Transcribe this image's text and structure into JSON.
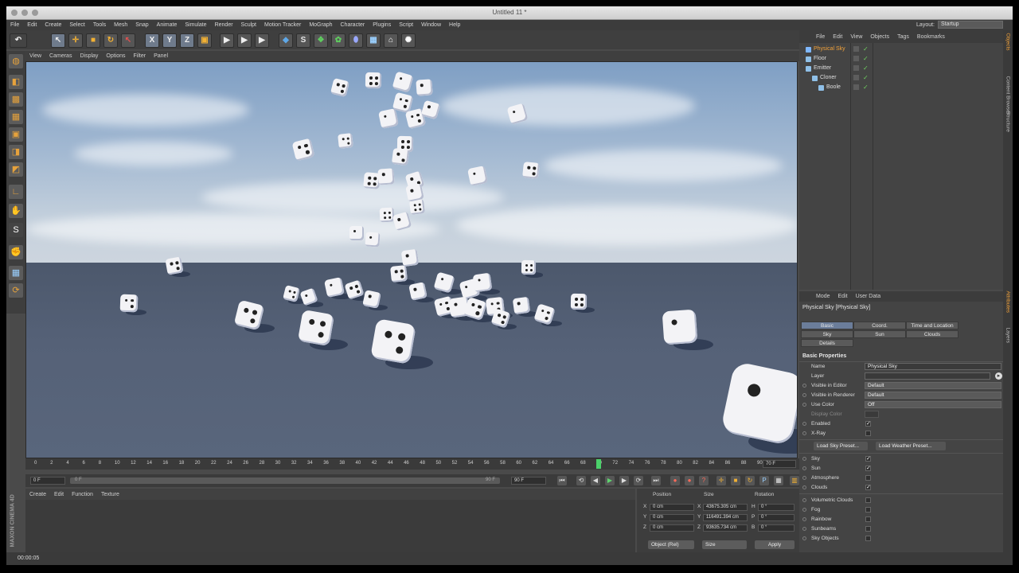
{
  "window": {
    "title": "Untitled 11 *"
  },
  "menu": [
    "File",
    "Edit",
    "Create",
    "Select",
    "Tools",
    "Mesh",
    "Snap",
    "Animate",
    "Simulate",
    "Render",
    "Sculpt",
    "Motion Tracker",
    "MoGraph",
    "Character",
    "Plugins",
    "Script",
    "Window",
    "Help"
  ],
  "layout": {
    "label": "Layout:",
    "value": "Startup"
  },
  "toolbar": {
    "x_label": "X",
    "y_label": "Y",
    "z_label": "Z"
  },
  "viewport_menu": [
    "View",
    "Cameras",
    "Display",
    "Options",
    "Filter",
    "Panel"
  ],
  "timeline": {
    "ticks": [
      "0",
      "2",
      "4",
      "6",
      "8",
      "10",
      "12",
      "14",
      "16",
      "18",
      "20",
      "22",
      "24",
      "26",
      "28",
      "30",
      "32",
      "34",
      "36",
      "38",
      "40",
      "42",
      "44",
      "46",
      "48",
      "50",
      "52",
      "54",
      "56",
      "58",
      "60",
      "62",
      "64",
      "66",
      "68",
      "70",
      "72",
      "74",
      "76",
      "78",
      "80",
      "82",
      "84",
      "86",
      "88",
      "90"
    ],
    "current_label": "70 F",
    "current_frame": 70,
    "max_frame": 90
  },
  "playback": {
    "start_field": "0 F",
    "slider_start": "0 F",
    "slider_end": "90 F",
    "end_field": "90 F"
  },
  "material_menu": [
    "Create",
    "Edit",
    "Function",
    "Texture"
  ],
  "coords": {
    "headers": {
      "position": "Position",
      "size": "Size",
      "rotation": "Rotation"
    },
    "rows": [
      {
        "axis": "X",
        "pos": "0 cm",
        "size_axis": "X",
        "size": "43675.305 cm",
        "rot_axis": "H",
        "rot": "0 °"
      },
      {
        "axis": "Y",
        "pos": "0 cm",
        "size_axis": "Y",
        "size": "116491.394 cm",
        "rot_axis": "P",
        "rot": "0 °"
      },
      {
        "axis": "Z",
        "pos": "0 cm",
        "size_axis": "Z",
        "size": "93635.734 cm",
        "rot_axis": "B",
        "rot": "0 °"
      }
    ],
    "mode": "Object (Rel)",
    "size_mode": "Size",
    "apply": "Apply"
  },
  "status": {
    "time": "00:00:05"
  },
  "brand": {
    "maxon": "MAXON CINEMA 4D"
  },
  "objects_menu": [
    "File",
    "Edit",
    "View",
    "Objects",
    "Tags",
    "Bookmarks"
  ],
  "objects": [
    {
      "name": "Physical Sky",
      "indent": 0,
      "active": true
    },
    {
      "name": "Floor",
      "indent": 0,
      "active": false
    },
    {
      "name": "Emitter",
      "indent": 0,
      "active": false
    },
    {
      "name": "Cloner",
      "indent": 1,
      "active": false
    },
    {
      "name": "Boole",
      "indent": 2,
      "active": false
    }
  ],
  "side_tabs": [
    "Objects",
    "Content Browser",
    "Structure",
    "Attributes",
    "Layers"
  ],
  "attributes": {
    "menu": [
      "Mode",
      "Edit",
      "User Data"
    ],
    "object_title": "Physical Sky [Physical Sky]",
    "tabs_row1": [
      "Basic",
      "Coord.",
      "Time and Location"
    ],
    "tabs_row2": [
      "Sky",
      "Sun",
      "Clouds"
    ],
    "tabs_row3": [
      "Details"
    ],
    "section": "Basic Properties",
    "name_label": "Name",
    "name_value": "Physical Sky",
    "layer_label": "Layer",
    "visible_editor_label": "Visible in Editor",
    "visible_editor_value": "Default",
    "visible_renderer_label": "Visible in Renderer",
    "visible_renderer_value": "Default",
    "use_color_label": "Use Color",
    "use_color_value": "Off",
    "display_color_label": "Display Color",
    "enabled_label": "Enabled",
    "xray_label": "X-Ray",
    "load_sky": "Load Sky Preset...",
    "load_weather": "Load Weather Preset...",
    "toggles": [
      {
        "label": "Sky",
        "checked": true
      },
      {
        "label": "Sun",
        "checked": true
      },
      {
        "label": "Atmosphere",
        "checked": false
      },
      {
        "label": "Clouds",
        "checked": true
      }
    ],
    "toggles2": [
      {
        "label": "Volumetric Clouds",
        "checked": false
      },
      {
        "label": "Fog",
        "checked": false
      },
      {
        "label": "Rainbow",
        "checked": false
      },
      {
        "label": "Sunbeams",
        "checked": false
      },
      {
        "label": "Sky Objects",
        "checked": false
      }
    ]
  }
}
